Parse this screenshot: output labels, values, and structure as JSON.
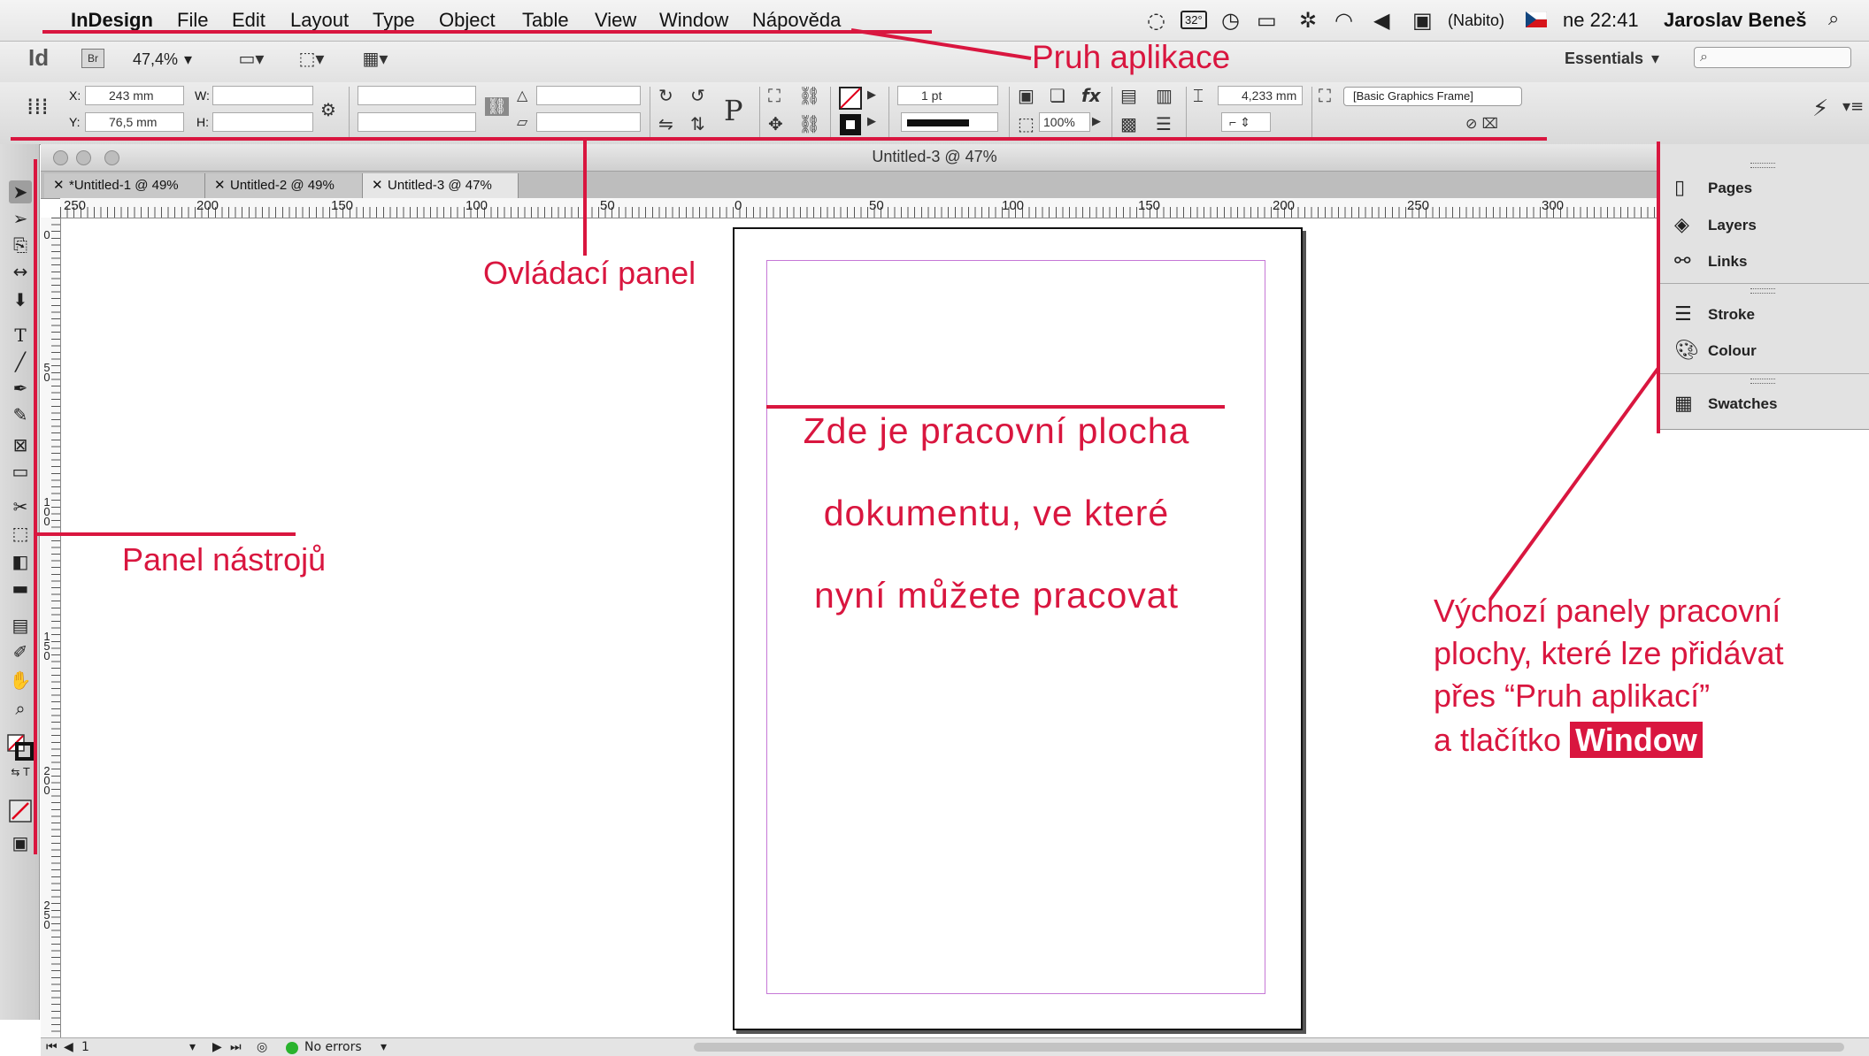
{
  "menubar": {
    "app_name": "InDesign",
    "items": [
      "File",
      "Edit",
      "Layout",
      "Type",
      "Object",
      "Table",
      "View",
      "Window",
      "Nápověda"
    ],
    "temperature": "32°",
    "input_label": "(Nabito)",
    "clock": "ne 22:41",
    "user": "Jaroslav Beneš"
  },
  "appbar": {
    "logo": "Id",
    "bridge": "Br",
    "zoom": "47,4%",
    "workspace": "Essentials"
  },
  "control": {
    "x_label": "X:",
    "x_value": "243 mm",
    "y_label": "Y:",
    "y_value": "76,5 mm",
    "w_label": "W:",
    "h_label": "H:",
    "stroke_weight": "1 pt",
    "opacity": "100%",
    "spacing": "4,233 mm",
    "frame_style": "[Basic Graphics Frame]"
  },
  "document": {
    "window_title": "Untitled-3 @ 47%",
    "tabs": [
      "*Untitled-1 @ 49%",
      "Untitled-2 @ 49%",
      "Untitled-3 @ 47%"
    ],
    "ruler_h": [
      "250",
      "200",
      "150",
      "100",
      "50",
      "0",
      "50",
      "100",
      "150",
      "200",
      "250",
      "300"
    ],
    "ruler_v": [
      "0",
      "5 0",
      "1 0 0",
      "1 5 0",
      "2 0 0",
      "2 5 0"
    ]
  },
  "status": {
    "page": "1",
    "errors": "No errors"
  },
  "panels": [
    "Pages",
    "Layers",
    "Links",
    "Stroke",
    "Colour",
    "Swatches"
  ],
  "annotations": {
    "app_bar": "Pruh aplikace",
    "control_panel": "Ovládací panel",
    "tools_panel": "Panel nástrojů",
    "workspace_1": "Zde je pracovní plocha",
    "workspace_2": "dokumentu, ve které",
    "workspace_3": "nyní můžete pracovat",
    "panels_1": "Výchozí panely pracovní",
    "panels_2": "plochy, které lze přidávat",
    "panels_3": "přes “Pruh aplikací”",
    "panels_4_prefix": "a tlačítko",
    "panels_4_button": "Window"
  },
  "colors": {
    "annotation": "#d9163f",
    "margin_guide": "#c678d6"
  }
}
